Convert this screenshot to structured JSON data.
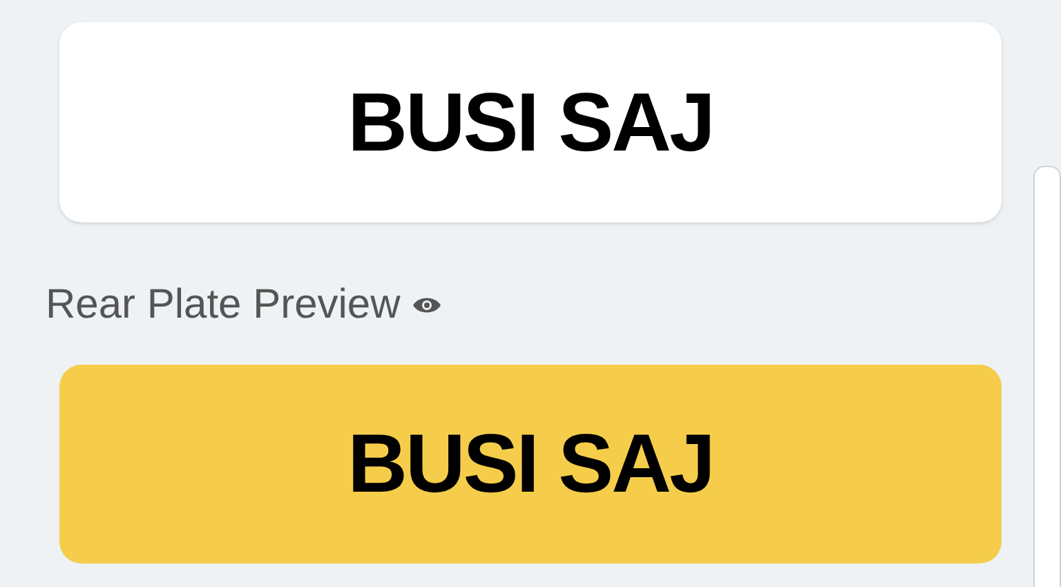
{
  "front_plate": {
    "text": "BUSI SAJ"
  },
  "rear_plate": {
    "label": "Rear Plate Preview",
    "text": "BUSI SAJ"
  }
}
